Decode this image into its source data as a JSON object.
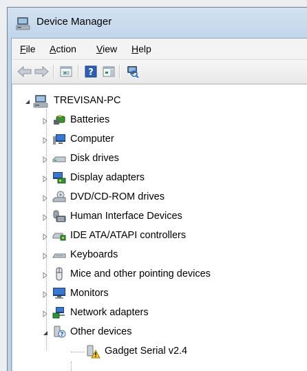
{
  "window": {
    "title": "Device Manager"
  },
  "menu": [
    {
      "label": "File",
      "mnemonic": "F",
      "rest": "ile"
    },
    {
      "label": "Action",
      "mnemonic": "A",
      "rest": "ction"
    },
    {
      "label": "View",
      "mnemonic": "V",
      "rest": "iew"
    },
    {
      "label": "Help",
      "mnemonic": "H",
      "rest": "elp"
    }
  ],
  "toolbar": {
    "buttons": [
      "back-arrow-icon",
      "forward-arrow-icon",
      "properties-icon",
      "help-icon",
      "action-pane-icon",
      "scan-hardware-icon"
    ]
  },
  "tree": {
    "root": {
      "label": "TREVISAN-PC",
      "icon": "computer-icon",
      "expanded": true
    },
    "items": [
      {
        "label": "Batteries",
        "icon": "battery-icon",
        "expanded": false
      },
      {
        "label": "Computer",
        "icon": "computer-monitor-icon",
        "expanded": false
      },
      {
        "label": "Disk drives",
        "icon": "disk-drive-icon",
        "expanded": false
      },
      {
        "label": "Display adapters",
        "icon": "display-adapter-icon",
        "expanded": false
      },
      {
        "label": "DVD/CD-ROM drives",
        "icon": "dvd-drive-icon",
        "expanded": false
      },
      {
        "label": "Human Interface Devices",
        "icon": "hid-icon",
        "expanded": false
      },
      {
        "label": "IDE ATA/ATAPI controllers",
        "icon": "ide-controller-icon",
        "expanded": false
      },
      {
        "label": "Keyboards",
        "icon": "keyboard-icon",
        "expanded": false
      },
      {
        "label": "Mice and other pointing devices",
        "icon": "mouse-icon",
        "expanded": false
      },
      {
        "label": "Monitors",
        "icon": "monitor-icon",
        "expanded": false
      },
      {
        "label": "Network adapters",
        "icon": "network-adapter-icon",
        "expanded": false
      },
      {
        "label": "Other devices",
        "icon": "unknown-device-icon",
        "expanded": true
      }
    ],
    "children": [
      {
        "label": "Gadget Serial v2.4",
        "icon": "warning-device-icon"
      }
    ]
  }
}
